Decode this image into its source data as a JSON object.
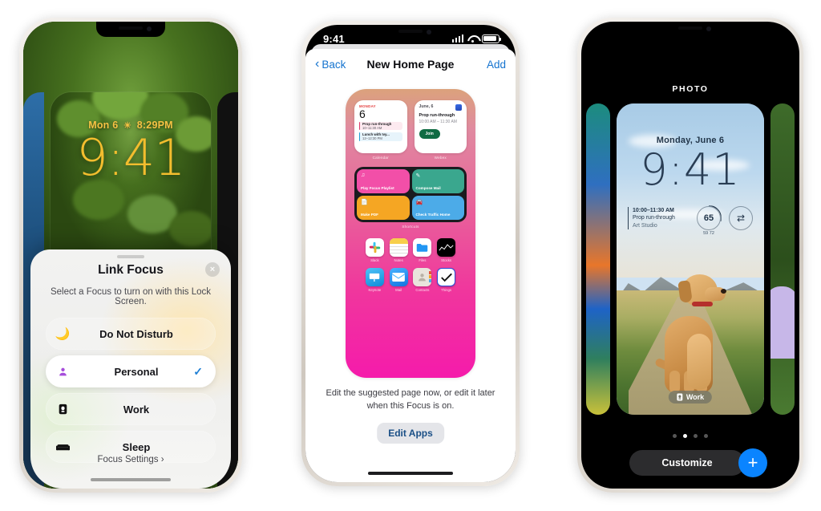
{
  "left_phone": {
    "lock_screen": {
      "date_weather": "Mon 6",
      "weather_icon": "sun-icon",
      "temp_time": "8:29PM",
      "time": "9:41"
    },
    "sheet": {
      "title": "Link Focus",
      "close_label": "×",
      "subtitle": "Select a Focus to turn on with this Lock Screen.",
      "options": [
        {
          "label": "Do Not Disturb",
          "icon": "moon-icon",
          "selected": false
        },
        {
          "label": "Personal",
          "icon": "person-icon",
          "selected": true
        },
        {
          "label": "Work",
          "icon": "briefcase-icon",
          "selected": false
        },
        {
          "label": "Sleep",
          "icon": "bed-icon",
          "selected": false
        }
      ],
      "check_glyph": "✓",
      "footer": "Focus Settings ›"
    }
  },
  "mid_phone": {
    "status": {
      "time": "9:41",
      "signal": "cellular-bars",
      "wifi": "wifi-icon",
      "battery": "battery-icon"
    },
    "nav": {
      "back": "Back",
      "title": "New Home Page",
      "add": "Add"
    },
    "widgets": {
      "calendar": {
        "label": "Calendar",
        "dow": "MONDAY",
        "day": "6",
        "events": [
          {
            "title": "Prop run-through",
            "time": "10–11:30 AM"
          },
          {
            "title": "Lunch with Ivy...",
            "time": "12–12:30 PM"
          }
        ]
      },
      "webex": {
        "label": "Webex",
        "date": "June, 6",
        "event": "Prop run-through",
        "time": "10:00 AM – 11:30 AM",
        "button": "Join"
      },
      "shortcuts": {
        "label": "Shortcuts",
        "items": [
          {
            "name": "Play Focus Playlist",
            "icon": "music-note-icon",
            "color": "#f24fa8"
          },
          {
            "name": "Compose Mail",
            "icon": "compose-icon",
            "color": "#3aa78e"
          },
          {
            "name": "Make PDF",
            "icon": "document-icon",
            "color": "#f5a623"
          },
          {
            "name": "Check Traffic Home",
            "icon": "car-icon",
            "color": "#4cabe8"
          }
        ]
      }
    },
    "apps": [
      {
        "name": "Slack",
        "icon": "slack-icon"
      },
      {
        "name": "Notes",
        "icon": "notes-icon"
      },
      {
        "name": "Files",
        "icon": "files-icon"
      },
      {
        "name": "Stocks",
        "icon": "stocks-icon"
      },
      {
        "name": "Keynote",
        "icon": "keynote-icon"
      },
      {
        "name": "Mail",
        "icon": "mail-icon"
      },
      {
        "name": "Contacts",
        "icon": "contacts-icon"
      },
      {
        "name": "Things",
        "icon": "things-icon"
      }
    ],
    "caption": "Edit the suggested page now, or edit it later when this Focus is on.",
    "edit_button": "Edit Apps"
  },
  "right_phone": {
    "wallpaper_label": "PHOTO",
    "lock_screen": {
      "date": "Monday, June 6",
      "time": "9:41",
      "calendar_widget": {
        "time": "10:00–11:30 AM",
        "title": "Prop run-through",
        "location": "Art Studio"
      },
      "temperature": "65",
      "low_high": "59  72",
      "activity_icon": "rings-icon"
    },
    "focus_badge": {
      "label": "Work",
      "icon": "briefcase-icon"
    },
    "page_dots": {
      "count": 4,
      "active_index": 1
    },
    "customize_button": "Customize",
    "add_button": "+"
  },
  "theme": {
    "accent_blue": "#0a84ff",
    "link_blue": "#1473cf",
    "lock_gold": "#f3bd2e",
    "sheet_white": "#ffffff",
    "page_gradient_top": "#dba27c",
    "page_gradient_bottom": "#f51bab"
  }
}
